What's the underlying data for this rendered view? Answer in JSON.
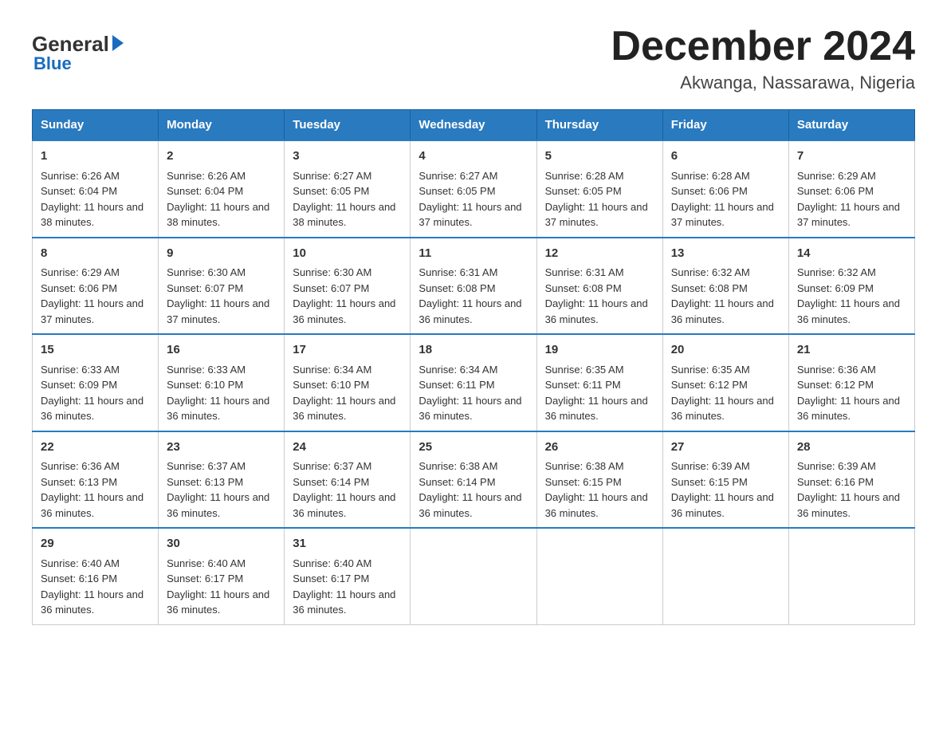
{
  "header": {
    "logo_general": "General",
    "logo_blue": "Blue",
    "title": "December 2024",
    "subtitle": "Akwanga, Nassarawa, Nigeria"
  },
  "weekdays": [
    "Sunday",
    "Monday",
    "Tuesday",
    "Wednesday",
    "Thursday",
    "Friday",
    "Saturday"
  ],
  "weeks": [
    [
      {
        "day": "1",
        "sunrise": "6:26 AM",
        "sunset": "6:04 PM",
        "daylight": "11 hours and 38 minutes."
      },
      {
        "day": "2",
        "sunrise": "6:26 AM",
        "sunset": "6:04 PM",
        "daylight": "11 hours and 38 minutes."
      },
      {
        "day": "3",
        "sunrise": "6:27 AM",
        "sunset": "6:05 PM",
        "daylight": "11 hours and 38 minutes."
      },
      {
        "day": "4",
        "sunrise": "6:27 AM",
        "sunset": "6:05 PM",
        "daylight": "11 hours and 37 minutes."
      },
      {
        "day": "5",
        "sunrise": "6:28 AM",
        "sunset": "6:05 PM",
        "daylight": "11 hours and 37 minutes."
      },
      {
        "day": "6",
        "sunrise": "6:28 AM",
        "sunset": "6:06 PM",
        "daylight": "11 hours and 37 minutes."
      },
      {
        "day": "7",
        "sunrise": "6:29 AM",
        "sunset": "6:06 PM",
        "daylight": "11 hours and 37 minutes."
      }
    ],
    [
      {
        "day": "8",
        "sunrise": "6:29 AM",
        "sunset": "6:06 PM",
        "daylight": "11 hours and 37 minutes."
      },
      {
        "day": "9",
        "sunrise": "6:30 AM",
        "sunset": "6:07 PM",
        "daylight": "11 hours and 37 minutes."
      },
      {
        "day": "10",
        "sunrise": "6:30 AM",
        "sunset": "6:07 PM",
        "daylight": "11 hours and 36 minutes."
      },
      {
        "day": "11",
        "sunrise": "6:31 AM",
        "sunset": "6:08 PM",
        "daylight": "11 hours and 36 minutes."
      },
      {
        "day": "12",
        "sunrise": "6:31 AM",
        "sunset": "6:08 PM",
        "daylight": "11 hours and 36 minutes."
      },
      {
        "day": "13",
        "sunrise": "6:32 AM",
        "sunset": "6:08 PM",
        "daylight": "11 hours and 36 minutes."
      },
      {
        "day": "14",
        "sunrise": "6:32 AM",
        "sunset": "6:09 PM",
        "daylight": "11 hours and 36 minutes."
      }
    ],
    [
      {
        "day": "15",
        "sunrise": "6:33 AM",
        "sunset": "6:09 PM",
        "daylight": "11 hours and 36 minutes."
      },
      {
        "day": "16",
        "sunrise": "6:33 AM",
        "sunset": "6:10 PM",
        "daylight": "11 hours and 36 minutes."
      },
      {
        "day": "17",
        "sunrise": "6:34 AM",
        "sunset": "6:10 PM",
        "daylight": "11 hours and 36 minutes."
      },
      {
        "day": "18",
        "sunrise": "6:34 AM",
        "sunset": "6:11 PM",
        "daylight": "11 hours and 36 minutes."
      },
      {
        "day": "19",
        "sunrise": "6:35 AM",
        "sunset": "6:11 PM",
        "daylight": "11 hours and 36 minutes."
      },
      {
        "day": "20",
        "sunrise": "6:35 AM",
        "sunset": "6:12 PM",
        "daylight": "11 hours and 36 minutes."
      },
      {
        "day": "21",
        "sunrise": "6:36 AM",
        "sunset": "6:12 PM",
        "daylight": "11 hours and 36 minutes."
      }
    ],
    [
      {
        "day": "22",
        "sunrise": "6:36 AM",
        "sunset": "6:13 PM",
        "daylight": "11 hours and 36 minutes."
      },
      {
        "day": "23",
        "sunrise": "6:37 AM",
        "sunset": "6:13 PM",
        "daylight": "11 hours and 36 minutes."
      },
      {
        "day": "24",
        "sunrise": "6:37 AM",
        "sunset": "6:14 PM",
        "daylight": "11 hours and 36 minutes."
      },
      {
        "day": "25",
        "sunrise": "6:38 AM",
        "sunset": "6:14 PM",
        "daylight": "11 hours and 36 minutes."
      },
      {
        "day": "26",
        "sunrise": "6:38 AM",
        "sunset": "6:15 PM",
        "daylight": "11 hours and 36 minutes."
      },
      {
        "day": "27",
        "sunrise": "6:39 AM",
        "sunset": "6:15 PM",
        "daylight": "11 hours and 36 minutes."
      },
      {
        "day": "28",
        "sunrise": "6:39 AM",
        "sunset": "6:16 PM",
        "daylight": "11 hours and 36 minutes."
      }
    ],
    [
      {
        "day": "29",
        "sunrise": "6:40 AM",
        "sunset": "6:16 PM",
        "daylight": "11 hours and 36 minutes."
      },
      {
        "day": "30",
        "sunrise": "6:40 AM",
        "sunset": "6:17 PM",
        "daylight": "11 hours and 36 minutes."
      },
      {
        "day": "31",
        "sunrise": "6:40 AM",
        "sunset": "6:17 PM",
        "daylight": "11 hours and 36 minutes."
      },
      null,
      null,
      null,
      null
    ]
  ],
  "labels": {
    "sunrise": "Sunrise:",
    "sunset": "Sunset:",
    "daylight": "Daylight:"
  }
}
